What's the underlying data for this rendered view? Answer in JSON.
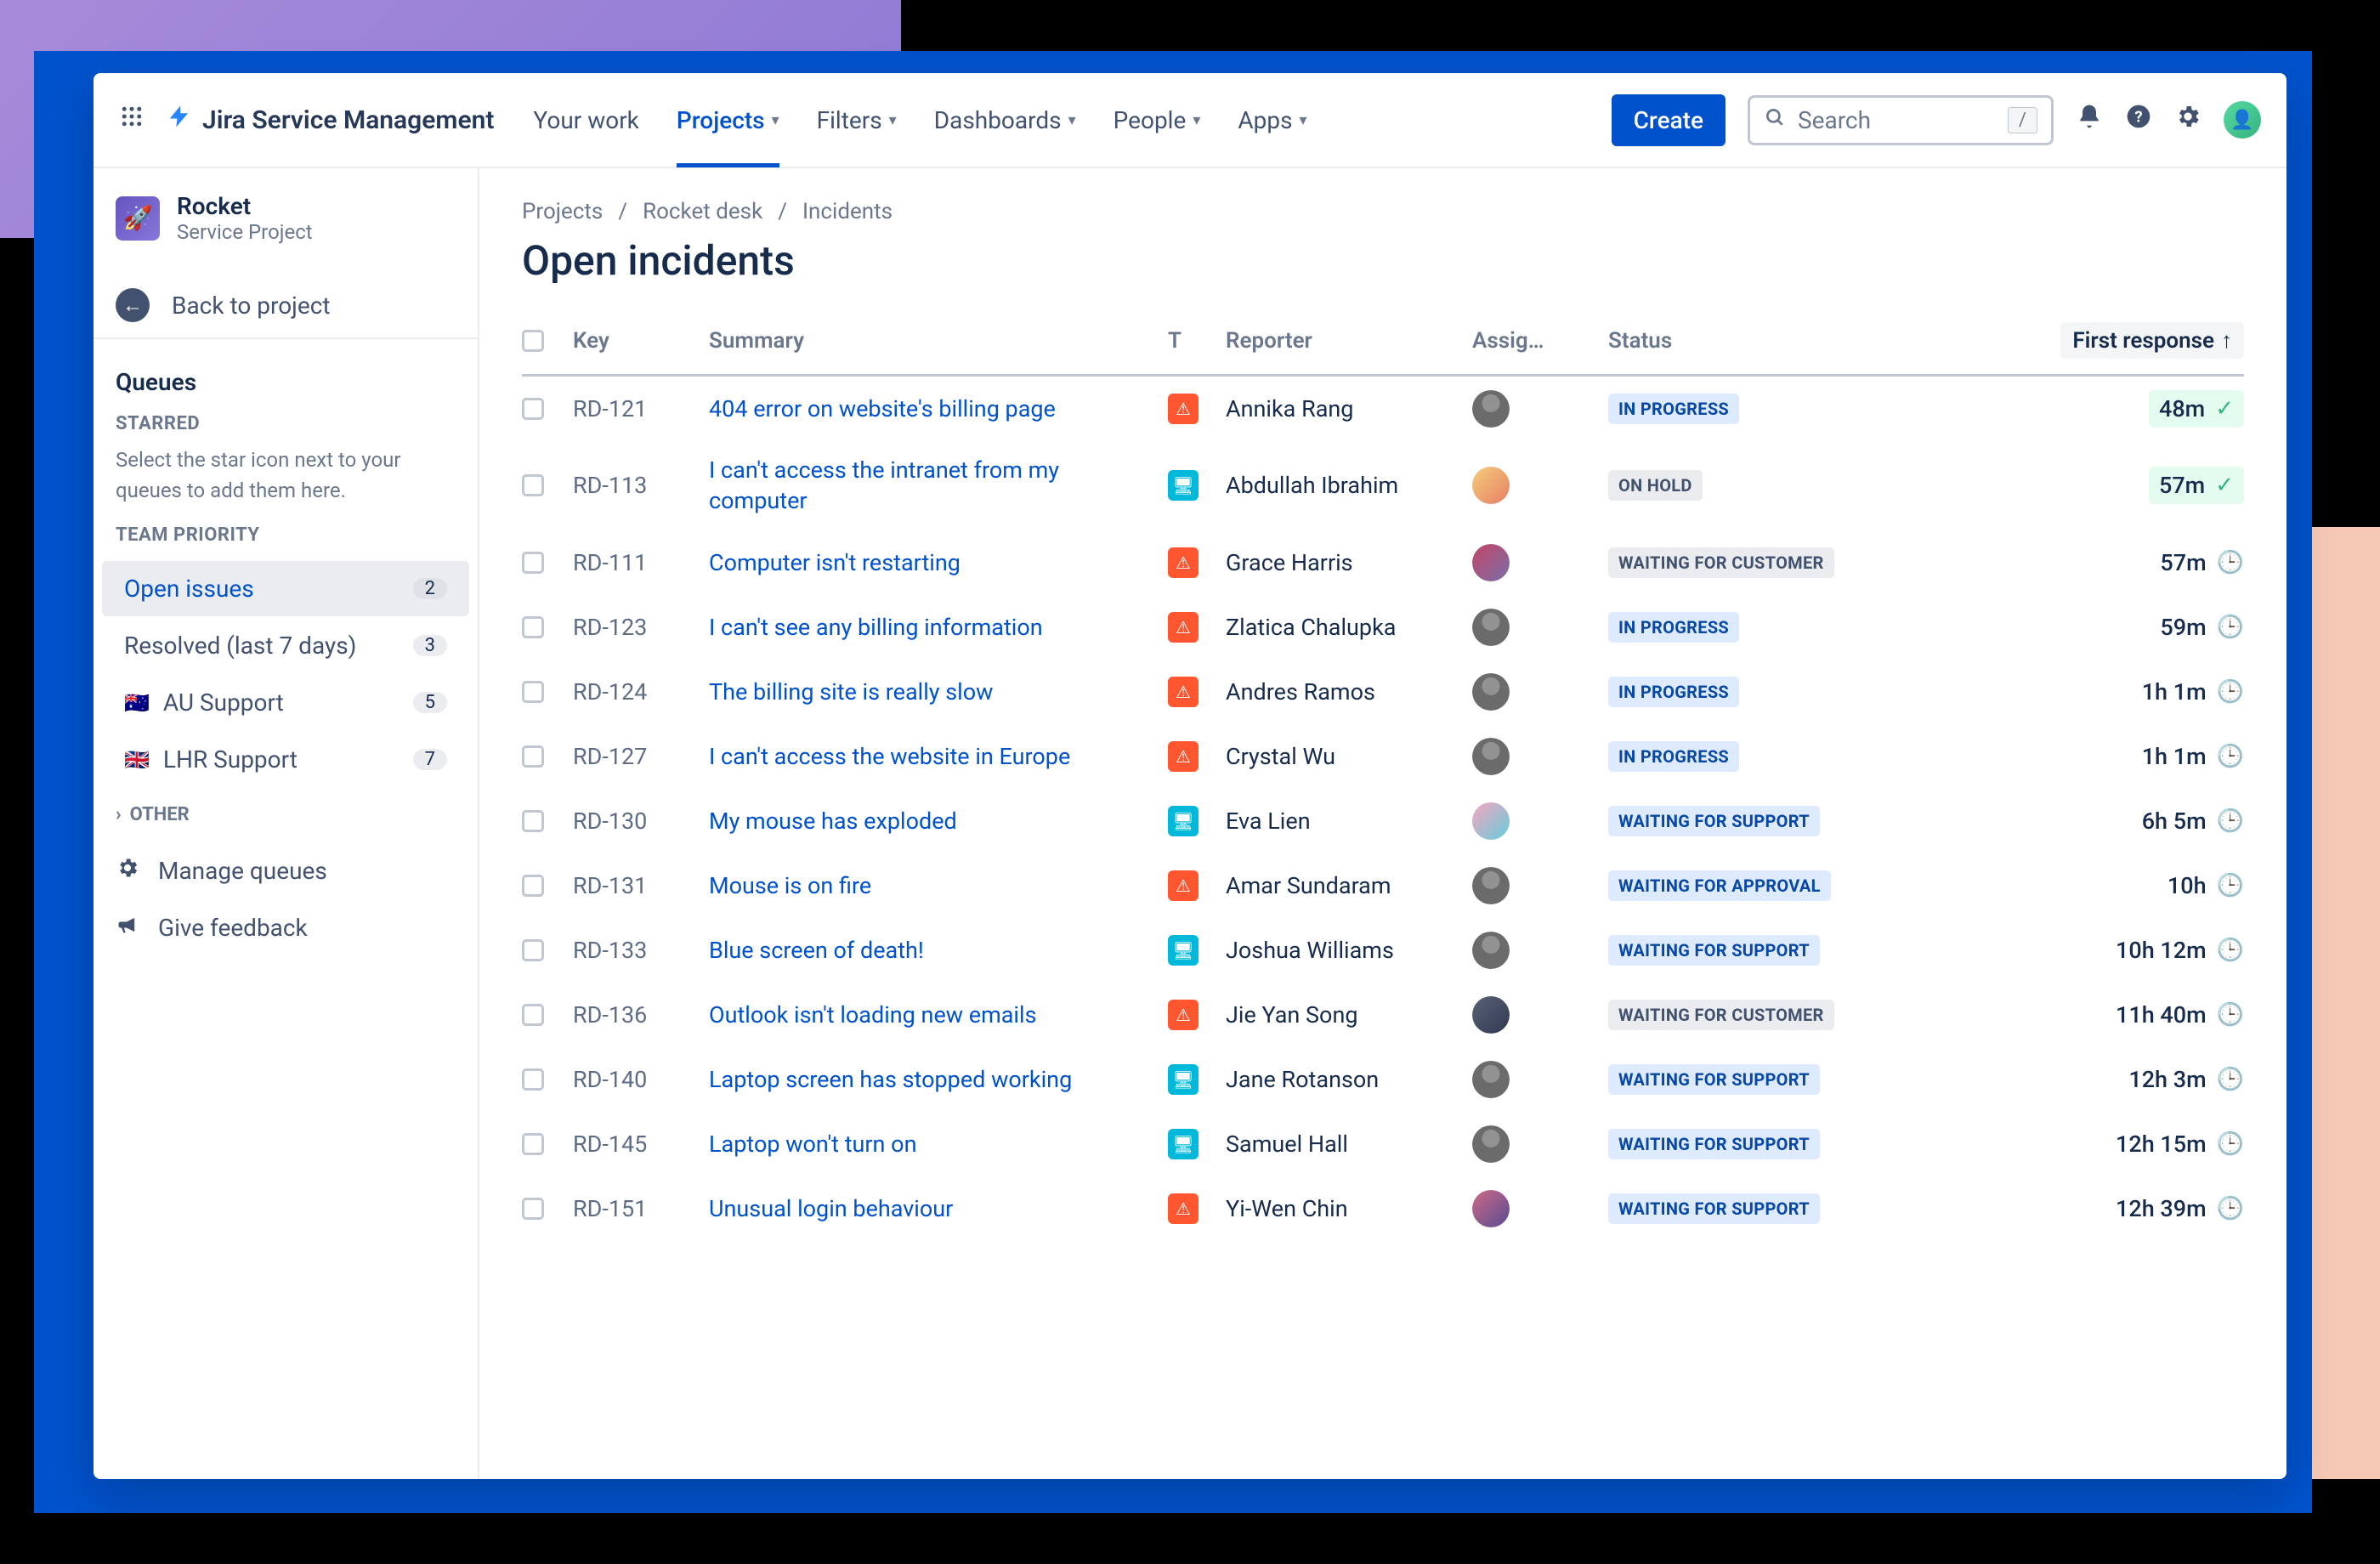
{
  "topnav": {
    "product": "Jira Service Management",
    "items": [
      "Your work",
      "Projects",
      "Filters",
      "Dashboards",
      "People",
      "Apps"
    ],
    "active_index": 1,
    "create": "Create",
    "search_placeholder": "Search"
  },
  "project": {
    "name": "Rocket",
    "type": "Service Project",
    "back": "Back to project"
  },
  "sidebar": {
    "queues_heading": "Queues",
    "starred_heading": "STARRED",
    "starred_help": "Select the star icon next to your queues to add them here.",
    "team_heading": "TEAM PRIORITY",
    "other_heading": "OTHER",
    "queues": [
      {
        "label": "Open issues",
        "count": "2",
        "selected": true,
        "flag": ""
      },
      {
        "label": "Resolved (last 7 days)",
        "count": "3",
        "selected": false,
        "flag": ""
      },
      {
        "label": "AU Support",
        "count": "5",
        "selected": false,
        "flag": "🇦🇺"
      },
      {
        "label": "LHR Support",
        "count": "7",
        "selected": false,
        "flag": "🇬🇧"
      }
    ],
    "manage": "Manage queues",
    "feedback": "Give feedback"
  },
  "breadcrumb": [
    "Projects",
    "Rocket desk",
    "Incidents"
  ],
  "page_title": "Open incidents",
  "columns": [
    "Key",
    "Summary",
    "T",
    "Reporter",
    "Assig…",
    "Status",
    "First response"
  ],
  "sort": {
    "col": "First response",
    "dir": "asc"
  },
  "status_labels": {
    "inprogress": "IN PROGRESS",
    "onhold": "ON HOLD",
    "waitcust": "WAITING FOR CUSTOMER",
    "waitsupp": "WAITING FOR SUPPORT",
    "waitappr": "WAITING FOR APPROVAL"
  },
  "rows": [
    {
      "key": "RD-121",
      "summary": "404 error on website's billing page",
      "type": "orange",
      "reporter": "Annika Rang",
      "av": "gray",
      "status": "inprogress",
      "first": "48m",
      "sla": "met"
    },
    {
      "key": "RD-113",
      "summary": "I can't access the intranet from my computer",
      "type": "teal",
      "reporter": "Abdullah Ibrahim",
      "av": "c1",
      "status": "onhold",
      "first": "57m",
      "sla": "met"
    },
    {
      "key": "RD-111",
      "summary": "Computer isn't restarting",
      "type": "orange",
      "reporter": "Grace Harris",
      "av": "c2",
      "status": "waitcust",
      "first": "57m",
      "sla": "pending"
    },
    {
      "key": "RD-123",
      "summary": "I can't see any billing information",
      "type": "orange",
      "reporter": "Zlatica Chalupka",
      "av": "gray",
      "status": "inprogress",
      "first": "59m",
      "sla": "pending"
    },
    {
      "key": "RD-124",
      "summary": "The billing site is really slow",
      "type": "orange",
      "reporter": "Andres Ramos",
      "av": "gray",
      "status": "inprogress",
      "first": "1h 1m",
      "sla": "pending"
    },
    {
      "key": "RD-127",
      "summary": "I can't access the website in Europe",
      "type": "orange",
      "reporter": "Crystal Wu",
      "av": "gray",
      "status": "inprogress",
      "first": "1h 1m",
      "sla": "pending"
    },
    {
      "key": "RD-130",
      "summary": "My mouse has exploded",
      "type": "teal",
      "reporter": "Eva Lien",
      "av": "c3",
      "status": "waitsupp",
      "first": "6h 5m",
      "sla": "pending"
    },
    {
      "key": "RD-131",
      "summary": "Mouse is on fire",
      "type": "orange",
      "reporter": "Amar Sundaram",
      "av": "gray",
      "status": "waitappr",
      "first": "10h",
      "sla": "pending"
    },
    {
      "key": "RD-133",
      "summary": "Blue screen of death!",
      "type": "teal",
      "reporter": "Joshua Williams",
      "av": "gray",
      "status": "waitsupp",
      "first": "10h 12m",
      "sla": "pending"
    },
    {
      "key": "RD-136",
      "summary": "Outlook isn't loading new emails",
      "type": "orange",
      "reporter": "Jie Yan Song",
      "av": "c4",
      "status": "waitcust",
      "first": "11h 40m",
      "sla": "pending"
    },
    {
      "key": "RD-140",
      "summary": "Laptop screen has stopped working",
      "type": "teal",
      "reporter": "Jane Rotanson",
      "av": "gray",
      "status": "waitsupp",
      "first": "12h 3m",
      "sla": "pending"
    },
    {
      "key": "RD-145",
      "summary": "Laptop won't turn on",
      "type": "teal",
      "reporter": "Samuel Hall",
      "av": "gray",
      "status": "waitsupp",
      "first": "12h 15m",
      "sla": "pending"
    },
    {
      "key": "RD-151",
      "summary": "Unusual login behaviour",
      "type": "orange",
      "reporter": "Yi-Wen Chin",
      "av": "c5",
      "status": "waitsupp",
      "first": "12h 39m",
      "sla": "pending"
    }
  ]
}
